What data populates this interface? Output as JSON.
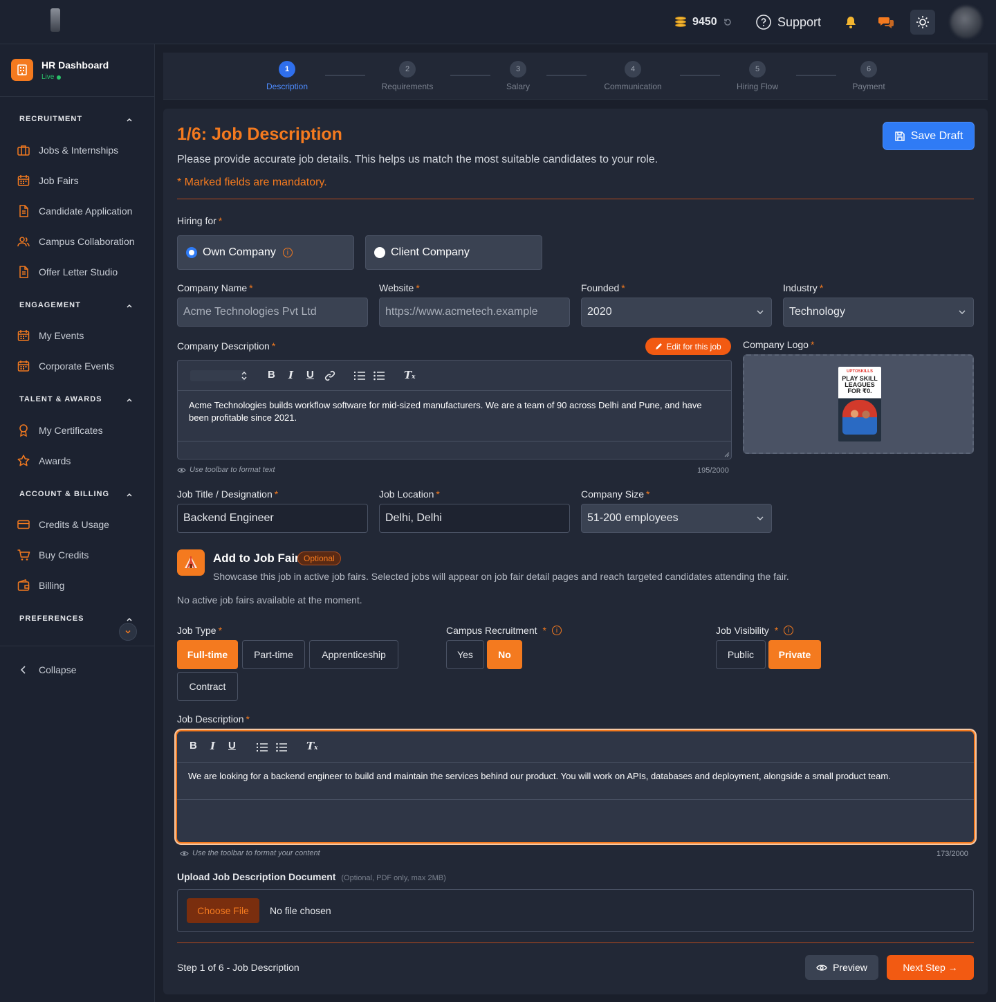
{
  "topbar": {
    "credits": "9450",
    "support_label": "Support"
  },
  "sidebar": {
    "brand_title": "HR Dashboard",
    "brand_status": "Live",
    "sections": {
      "recruitment": "RECRUITMENT",
      "engagement": "ENGAGEMENT",
      "talent": "TALENT & AWARDS",
      "account": "ACCOUNT & BILLING",
      "preferences": "PREFERENCES"
    },
    "items": {
      "jobs": "Jobs & Internships",
      "job_fairs": "Job Fairs",
      "candidate_application": "Candidate Application",
      "campus_collaboration": "Campus Collaboration",
      "offer_letter": "Offer Letter Studio",
      "my_events": "My Events",
      "corporate_events": "Corporate Events",
      "my_certificates": "My Certificates",
      "awards": "Awards",
      "credits_usage": "Credits & Usage",
      "buy_credits": "Buy Credits",
      "billing": "Billing"
    },
    "collapse_label": "Collapse"
  },
  "stepper": {
    "steps": [
      {
        "num": "1",
        "label": "Description"
      },
      {
        "num": "2",
        "label": "Requirements"
      },
      {
        "num": "3",
        "label": "Salary"
      },
      {
        "num": "4",
        "label": "Communication"
      },
      {
        "num": "5",
        "label": "Hiring Flow"
      },
      {
        "num": "6",
        "label": "Payment"
      }
    ],
    "active": 1
  },
  "form": {
    "title": "1/6: Job Description",
    "subtitle": "Please provide accurate job details. This helps us match the most suitable candidates to your role.",
    "mandatory_note": "* Marked fields are mandatory.",
    "save_draft": "Save Draft",
    "hiring_for_label": "Hiring for",
    "hiring_options": [
      "Own Company",
      "Client Company"
    ],
    "hiring_selected": "Own Company",
    "company_name_label": "Company Name",
    "company_name": "Acme Technologies Pvt Ltd",
    "website_label": "Website",
    "website": "https://www.acmetech.example",
    "founded_label": "Founded",
    "founded": "2020",
    "industry_label": "Industry",
    "industry": "Technology",
    "company_description_label": "Company Description",
    "edit_for_job": "Edit for this job",
    "company_description": "Acme Technologies builds workflow software for mid-sized manufacturers. We are a team of 90 across Delhi and Pune, and have been profitable since 2021.",
    "company_desc_hint": "Use toolbar to format text",
    "company_desc_count": "195/2000",
    "company_logo_label": "Company Logo",
    "logo_text_brand": "UPTOSKILLS",
    "logo_text_main": "PLAY SKILL LEAGUES FOR ₹0.",
    "job_title_label": "Job Title / Designation",
    "job_title": "Backend Engineer",
    "job_location_label": "Job Location",
    "job_location": "Delhi, Delhi",
    "company_size_label": "Company Size",
    "company_size": "51-200 employees",
    "job_fair_title": "Add to Job Fair",
    "job_fair_optional": "Optional",
    "job_fair_desc": "Showcase this job in active job fairs. Selected jobs will appear on job fair detail pages and reach targeted candidates attending the fair.",
    "job_fair_none": "No active job fairs available at the moment.",
    "job_type_label": "Job Type",
    "job_types": [
      "Full-time",
      "Part-time",
      "Apprenticeship",
      "Contract"
    ],
    "job_type_selected": "Full-time",
    "campus_label": "Campus Recruitment",
    "campus_options": [
      "Yes",
      "No"
    ],
    "campus_selected": "No",
    "visibility_label": "Job Visibility",
    "visibility_options": [
      "Public",
      "Private"
    ],
    "visibility_selected": "Private",
    "job_description_label": "Job Description",
    "job_description": "We are looking for a backend engineer to build and maintain the services behind our product. You will work on APIs, databases and deployment, alongside a small product team.",
    "job_desc_hint": "Use the toolbar to format your content",
    "job_desc_count": "173/2000",
    "upload_label": "Upload Job Description Document",
    "upload_note": "(Optional, PDF only, max 2MB)",
    "choose_file": "Choose File",
    "no_file": "No file chosen",
    "footer_step": "Step 1 of 6 - Job Description",
    "preview": "Preview",
    "next_step": "Next Step →"
  },
  "colors": {
    "accent": "#f47a1f",
    "primary": "#2f7bf5",
    "background": "#1a1f2b",
    "panel": "#222836"
  }
}
